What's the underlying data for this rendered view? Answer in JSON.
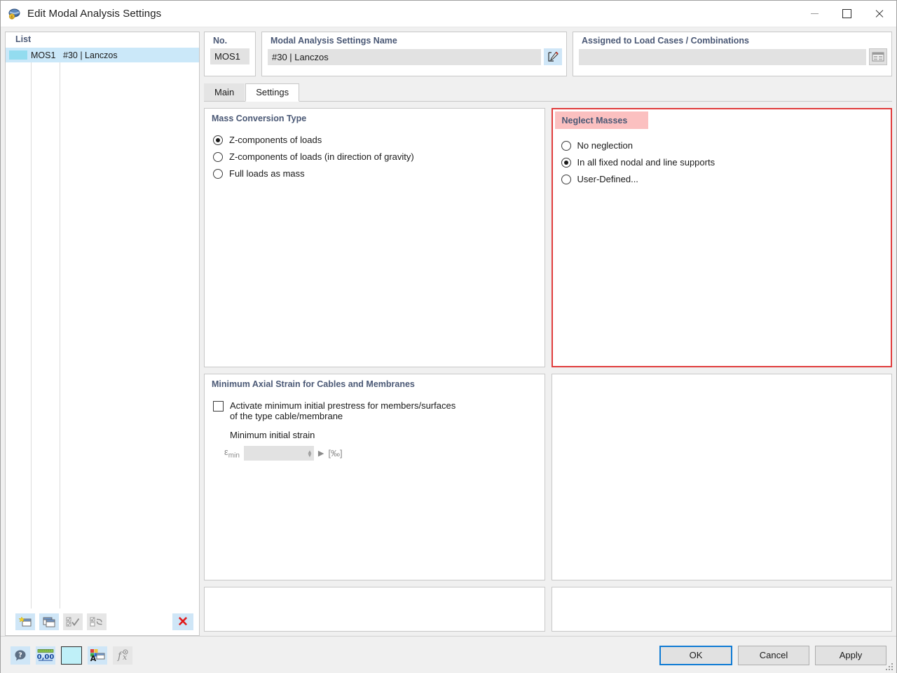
{
  "window": {
    "title": "Edit Modal Analysis Settings",
    "app_icon": "modal-analysis-icon",
    "minimize_label": "–",
    "maximize_label": "□",
    "close_label": "✕"
  },
  "list_panel": {
    "header": "List",
    "columns": [
      "color",
      "no",
      "name"
    ],
    "rows": [
      {
        "no": "MOS1",
        "name": "#30 | Lanczos",
        "color": "#93dcef",
        "selected": true
      }
    ],
    "toolbar": [
      {
        "name": "new-entry-button",
        "title": "New",
        "enabled": true
      },
      {
        "name": "copy-entry-button",
        "title": "Copy",
        "enabled": true
      },
      {
        "name": "select-all-button",
        "title": "Select All",
        "enabled": false
      },
      {
        "name": "invert-selection-button",
        "title": "Invert Selection",
        "enabled": false
      },
      {
        "name": "delete-entry-button",
        "title": "Delete",
        "enabled": true,
        "glyph": "✕"
      }
    ]
  },
  "no_box": {
    "title": "No.",
    "value": "MOS1"
  },
  "name_box": {
    "title": "Modal Analysis Settings Name",
    "value": "#30 | Lanczos",
    "edit_button": "edit-name-button"
  },
  "assigned_box": {
    "title": "Assigned to Load Cases / Combinations",
    "value": "",
    "picker_button": "assigned-picker-button"
  },
  "tabs": [
    {
      "label": "Main",
      "active": false
    },
    {
      "label": "Settings",
      "active": true
    }
  ],
  "mass_conversion": {
    "title": "Mass Conversion Type",
    "options": [
      {
        "label": "Z-components of loads",
        "checked": true
      },
      {
        "label": "Z-components of loads (in direction of gravity)",
        "checked": false
      },
      {
        "label": "Full loads as mass",
        "checked": false
      }
    ]
  },
  "neglect_masses": {
    "title": "Neglect Masses",
    "title_highlight_color": "#fbc0c0",
    "panel_border_color": "#e03c3c",
    "options": [
      {
        "label": "No neglection",
        "checked": false
      },
      {
        "label": "In all fixed nodal and line supports",
        "checked": true
      },
      {
        "label": "User-Defined...",
        "checked": false
      }
    ]
  },
  "min_axial_strain": {
    "title": "Minimum Axial Strain for Cables and Membranes",
    "checkbox": {
      "label_line1": "Activate minimum initial prestress for members/surfaces",
      "label_line2": "of the type cable/membrane",
      "checked": false
    },
    "sub_label": "Minimum initial strain",
    "field": {
      "symbol": "ε",
      "symbol_sub": "min",
      "value": "",
      "unit": "[‰]",
      "enabled": false
    }
  },
  "bottom_toolbar": [
    {
      "name": "help-button",
      "glyph": "?",
      "enabled": true
    },
    {
      "name": "decimal-places-button",
      "glyph": "0,00",
      "enabled": true
    },
    {
      "name": "color-swatch-button",
      "glyph": "",
      "enabled": true,
      "color": "#bff0f8"
    },
    {
      "name": "display-properties-button",
      "glyph": "A",
      "enabled": true
    },
    {
      "name": "formula-button",
      "glyph": "fx",
      "enabled": false
    }
  ],
  "actions": {
    "ok": "OK",
    "cancel": "Cancel",
    "apply": "Apply"
  }
}
